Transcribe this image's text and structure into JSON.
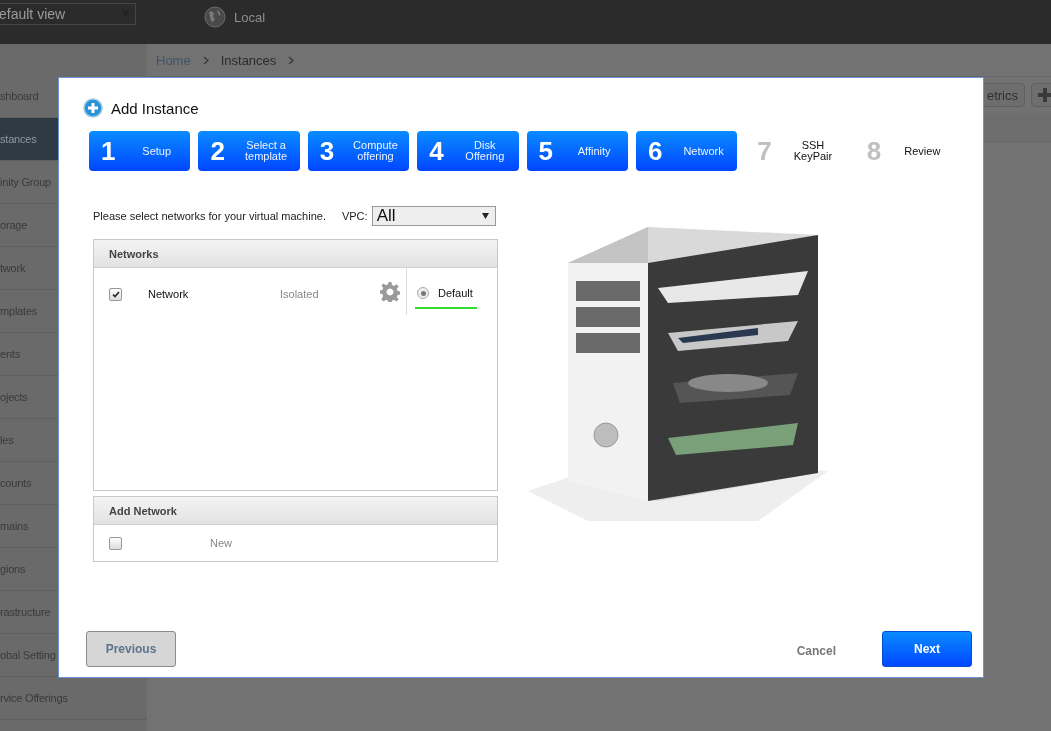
{
  "top_bar": {
    "view_select": "efault view",
    "zone": "Local"
  },
  "sidebar": {
    "items": [
      {
        "label": "shboard",
        "selected": false
      },
      {
        "label": "stances",
        "selected": true
      },
      {
        "label": "inity Group",
        "selected": false
      },
      {
        "label": "orage",
        "selected": false
      },
      {
        "label": "twork",
        "selected": false
      },
      {
        "label": "mplates",
        "selected": false
      },
      {
        "label": "ents",
        "selected": false
      },
      {
        "label": "ojects",
        "selected": false
      },
      {
        "label": "les",
        "selected": false
      },
      {
        "label": "counts",
        "selected": false
      },
      {
        "label": "mains",
        "selected": false
      },
      {
        "label": "gions",
        "selected": false
      },
      {
        "label": "rastructure",
        "selected": false
      },
      {
        "label": "obal Setting",
        "selected": false
      },
      {
        "label": "rvice Offerings",
        "selected": false
      }
    ]
  },
  "breadcrumb": [
    "Home",
    "Instances"
  ],
  "toolbar": {
    "metrics_button": "etrics"
  },
  "dialog": {
    "title": "Add Instance",
    "steps": [
      {
        "number": "1",
        "label": "Setup",
        "active": true
      },
      {
        "number": "2",
        "label": "Select a template",
        "active": true
      },
      {
        "number": "3",
        "label": "Compute offering",
        "active": true
      },
      {
        "number": "4",
        "label": "Disk Offering",
        "active": true
      },
      {
        "number": "5",
        "label": "Affinity",
        "active": true
      },
      {
        "number": "6",
        "label": "Network",
        "active": true
      },
      {
        "number": "7",
        "label": "SSH KeyPair",
        "active": false
      },
      {
        "number": "8",
        "label": "Review",
        "active": false
      }
    ],
    "instruction": "Please select networks for your virtual machine.",
    "vpc": {
      "label": "VPC:",
      "value": "All"
    },
    "networks": {
      "header": "Networks",
      "rows": [
        {
          "name": "Network",
          "type": "Isolated",
          "checked": true,
          "default_label": "Default",
          "default_selected": true
        }
      ]
    },
    "add_network": {
      "header": "Add Network",
      "label": "New",
      "checked": false
    },
    "buttons": {
      "previous": "Previous",
      "cancel": "Cancel",
      "next": "Next"
    }
  }
}
